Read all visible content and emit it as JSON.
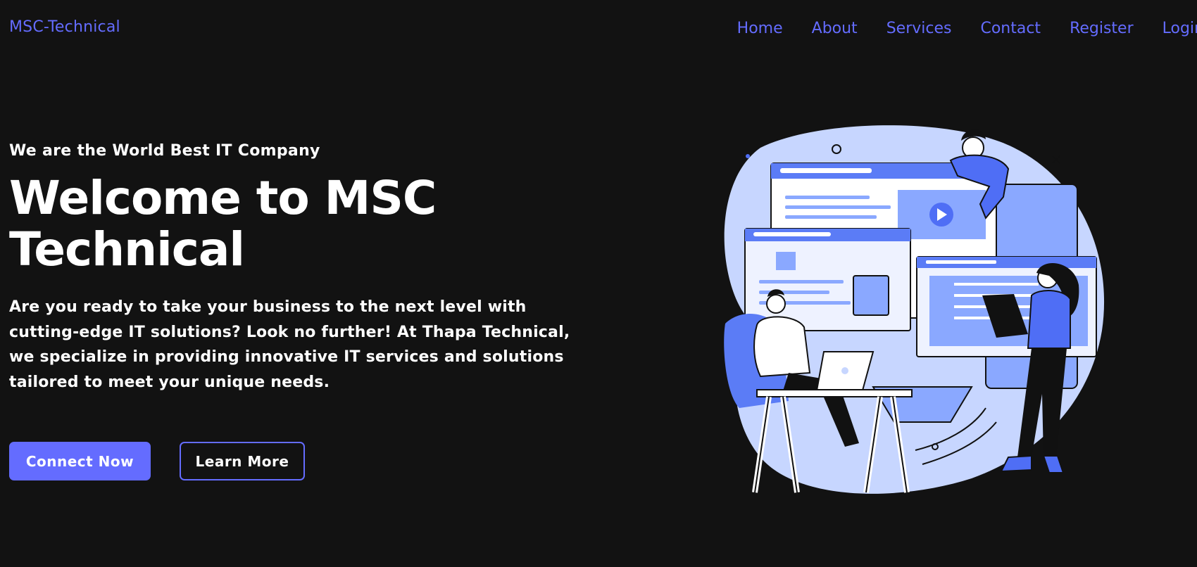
{
  "header": {
    "logo": "MSC-Technical",
    "nav": [
      "Home",
      "About",
      "Services",
      "Contact",
      "Register",
      "Login"
    ]
  },
  "hero": {
    "tagline": "We are the World Best IT Company",
    "headline_line1": "Welcome to MSC",
    "headline_line2": "Technical",
    "description": "Are you ready to take your business to the next level with cutting-edge IT solutions? Look no further! At Thapa Technical, we specialize in providing innovative IT services and solutions tailored to meet your unique needs.",
    "primary_button": "Connect Now",
    "secondary_button": "Learn More"
  },
  "colors": {
    "background": "#121212",
    "accent": "#646cff",
    "text": "#ffffff",
    "illustration_light": "#c7d6ff",
    "illustration_mid": "#8aa8ff",
    "illustration_dark": "#4f6ef5"
  }
}
